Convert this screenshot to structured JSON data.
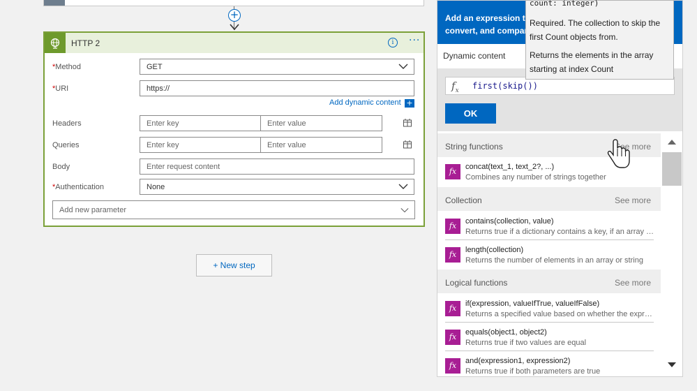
{
  "http_card": {
    "title": "HTTP 2",
    "fields": {
      "method": {
        "label": "Method",
        "required_mark": "*",
        "value": "GET"
      },
      "uri": {
        "label": "URI",
        "required_mark": "*",
        "value": "https://"
      },
      "headers": {
        "label": "Headers",
        "key_placeholder": "Enter key",
        "value_placeholder": "Enter value"
      },
      "queries": {
        "label": "Queries",
        "key_placeholder": "Enter key",
        "value_placeholder": "Enter value"
      },
      "body": {
        "label": "Body",
        "placeholder": "Enter request content"
      },
      "authentication": {
        "label": "Authentication",
        "required_mark": "*",
        "value": "None"
      }
    },
    "add_dynamic_content": "Add dynamic content",
    "add_dynamic_plus": "+",
    "add_new_parameter": "Add new parameter"
  },
  "new_step": "+ New step",
  "panel": {
    "header_line1": "Add an expression to c",
    "header_line2": "convert, and compare",
    "tab_dynamic": "Dynamic content",
    "expression": "first(skip())",
    "ok": "OK",
    "sections": [
      {
        "title": "String functions",
        "see_more": "See more"
      },
      {
        "title": "Collection",
        "see_more": "See more"
      },
      {
        "title": "Logical functions",
        "see_more": "See more"
      }
    ],
    "functions": [
      {
        "name": "concat(text_1, text_2?, ...)",
        "desc": "Combines any number of strings together"
      },
      {
        "name": "contains(collection, value)",
        "desc": "Returns true if a dictionary contains a key, if an array c..."
      },
      {
        "name": "length(collection)",
        "desc": "Returns the number of elements in an array or string"
      },
      {
        "name": "if(expression, valueIfTrue, valueIfFalse)",
        "desc": "Returns a specified value based on whether the expres..."
      },
      {
        "name": "equals(object1, object2)",
        "desc": "Returns true if two values are equal"
      },
      {
        "name": "and(expression1, expression2)",
        "desc": "Returns true if both parameters are true"
      }
    ]
  },
  "tooltip": {
    "signature": "count: integer)",
    "line1": "Required. The collection to skip the first Count objects from.",
    "line2": "Returns the elements in the array starting at index Count"
  },
  "colors": {
    "accent_blue": "#0067c0",
    "card_green": "#7ba038",
    "fx_purple": "#a81e94"
  }
}
